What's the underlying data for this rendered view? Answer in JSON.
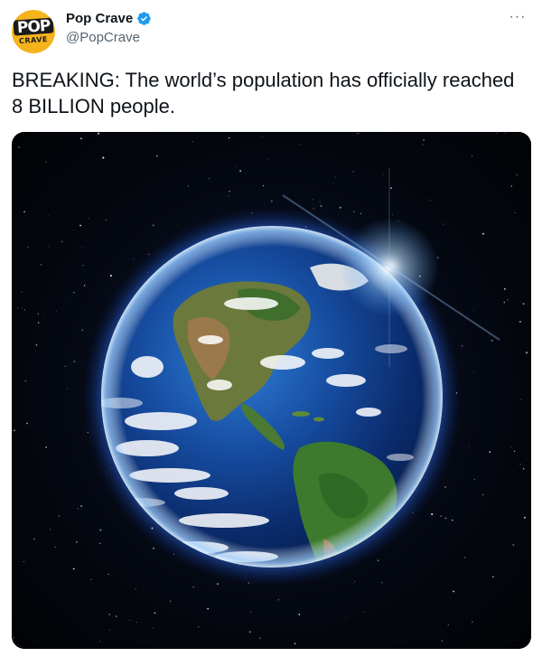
{
  "tweet": {
    "author": {
      "display_name": "Pop Crave",
      "handle": "@PopCrave",
      "verified": true,
      "avatar_icon": "pop-crave-logo-icon",
      "avatar_text_top": "POP",
      "avatar_text_bottom": "CRAVE",
      "avatar_color": "#f5b31c"
    },
    "text": "BREAKING: The world’s population has officially reached 8 BILLION people.",
    "more_icon": "more-options-icon",
    "media": {
      "description_icon": "earth-from-space-image"
    }
  },
  "colors": {
    "text_primary": "#0f1419",
    "text_secondary": "#536471",
    "verified_blue": "#1d9bf0"
  }
}
